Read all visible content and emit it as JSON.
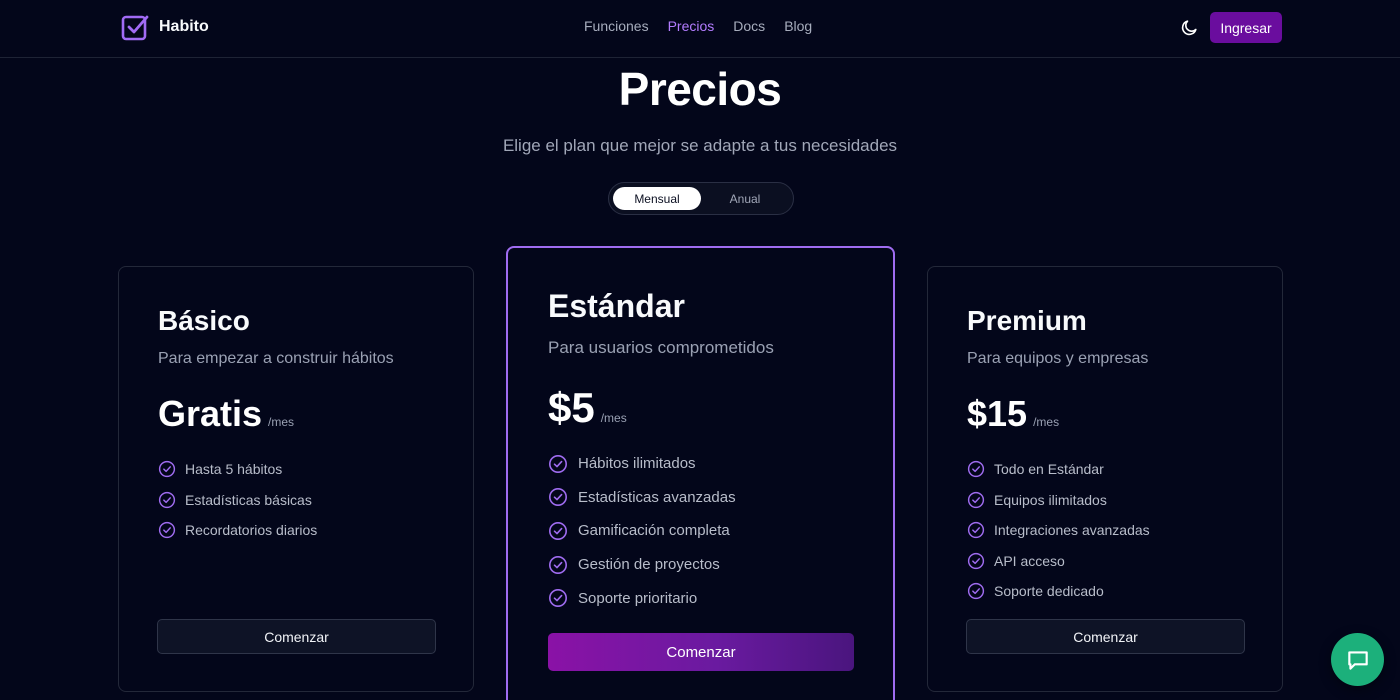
{
  "brand": {
    "name": "Habito"
  },
  "nav": {
    "items": [
      {
        "label": "Funciones",
        "active": false
      },
      {
        "label": "Precios",
        "active": true
      },
      {
        "label": "Docs",
        "active": false
      },
      {
        "label": "Blog",
        "active": false
      }
    ],
    "theme_icon": "moon-icon",
    "login_label": "Ingresar"
  },
  "hero": {
    "title": "Precios",
    "subtitle": "Elige el plan que mejor se adapte a tus necesidades"
  },
  "billing": {
    "options": [
      "Mensual",
      "Anual"
    ],
    "selected": "Mensual"
  },
  "plans": [
    {
      "name": "Básico",
      "description": "Para empezar a construir hábitos",
      "price": "Gratis",
      "period": "/mes",
      "features": [
        "Hasta 5 hábitos",
        "Estadísticas básicas",
        "Recordatorios diarios"
      ],
      "cta": "Comenzar",
      "highlighted": false
    },
    {
      "name": "Estándar",
      "description": "Para usuarios comprometidos",
      "price": "$5",
      "period": "/mes",
      "features": [
        "Hábitos ilimitados",
        "Estadísticas avanzadas",
        "Gamificación completa",
        "Gestión de proyectos",
        "Soporte prioritario"
      ],
      "cta": "Comenzar",
      "highlighted": true
    },
    {
      "name": "Premium",
      "description": "Para equipos y empresas",
      "price": "$15",
      "period": "/mes",
      "features": [
        "Todo en Estándar",
        "Equipos ilimitados",
        "Integraciones avanzadas",
        "API acceso",
        "Soporte dedicado"
      ],
      "cta": "Comenzar",
      "highlighted": false
    }
  ],
  "chat": {
    "icon": "chat-bubble-icon"
  },
  "colors": {
    "background": "#03061a",
    "accent": "#9f6cf0",
    "brand_purple": "#6a0d9e",
    "chat_green": "#1cb07b"
  }
}
